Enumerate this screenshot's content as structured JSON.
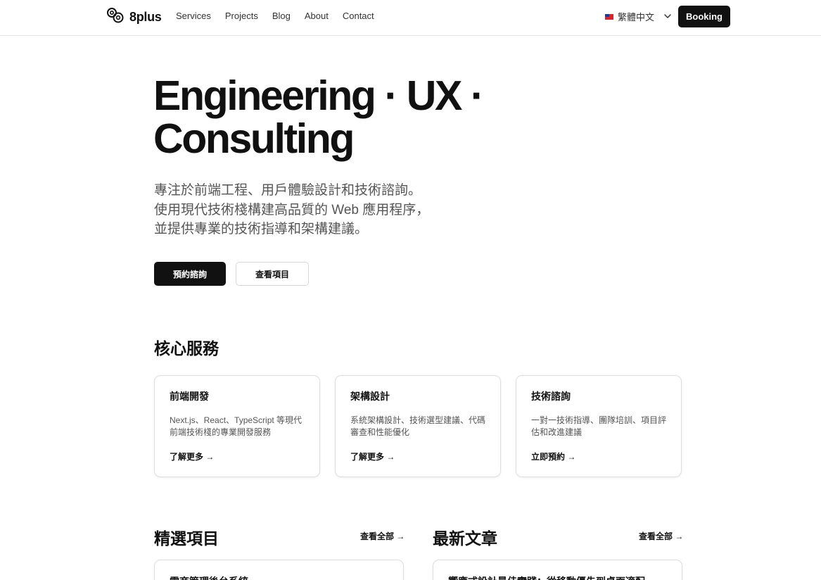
{
  "header": {
    "logo_text": "8plus",
    "nav": [
      "Services",
      "Projects",
      "Blog",
      "About",
      "Contact"
    ],
    "language": "繁體中文",
    "booking_label": "Booking"
  },
  "hero": {
    "title_line1": "Engineering · UX ·",
    "title_line2": "Consulting",
    "desc_lines": [
      "專注於前端工程、用戶體驗設計和技術諮詢。",
      "使用現代技術棧構建高品質的 Web 應用程序，",
      "並提供專業的技術指導和架構建議。"
    ],
    "primary_cta": "預約諮詢",
    "secondary_cta": "查看項目"
  },
  "services": {
    "title": "核心服務",
    "cards": [
      {
        "title": "前端開發",
        "desc": "Next.js、React、TypeScript 等現代前端技術棧的專業開發服務",
        "link": "了解更多 →"
      },
      {
        "title": "架構設計",
        "desc": "系統架構設計、技術選型建議、代碼審查和性能優化",
        "link": "了解更多 →"
      },
      {
        "title": "技術諮詢",
        "desc": "一對一技術指導、團隊培訓、項目評估和改進建議",
        "link": "立即預約 →"
      }
    ]
  },
  "projects": {
    "title": "精選項目",
    "view_all": "查看全部 →",
    "first_item": "電商管理後台系統"
  },
  "articles": {
    "title": "最新文章",
    "view_all": "查看全部 →",
    "first_item": "響應式設計最佳實踐：從移動優先到桌面適配"
  },
  "colors": {
    "primary": "#111111",
    "text_muted": "#555555",
    "border": "#dedede"
  },
  "icons": [
    "logo-rings-icon",
    "taiwan-flag-icon",
    "chevron-down-icon"
  ]
}
